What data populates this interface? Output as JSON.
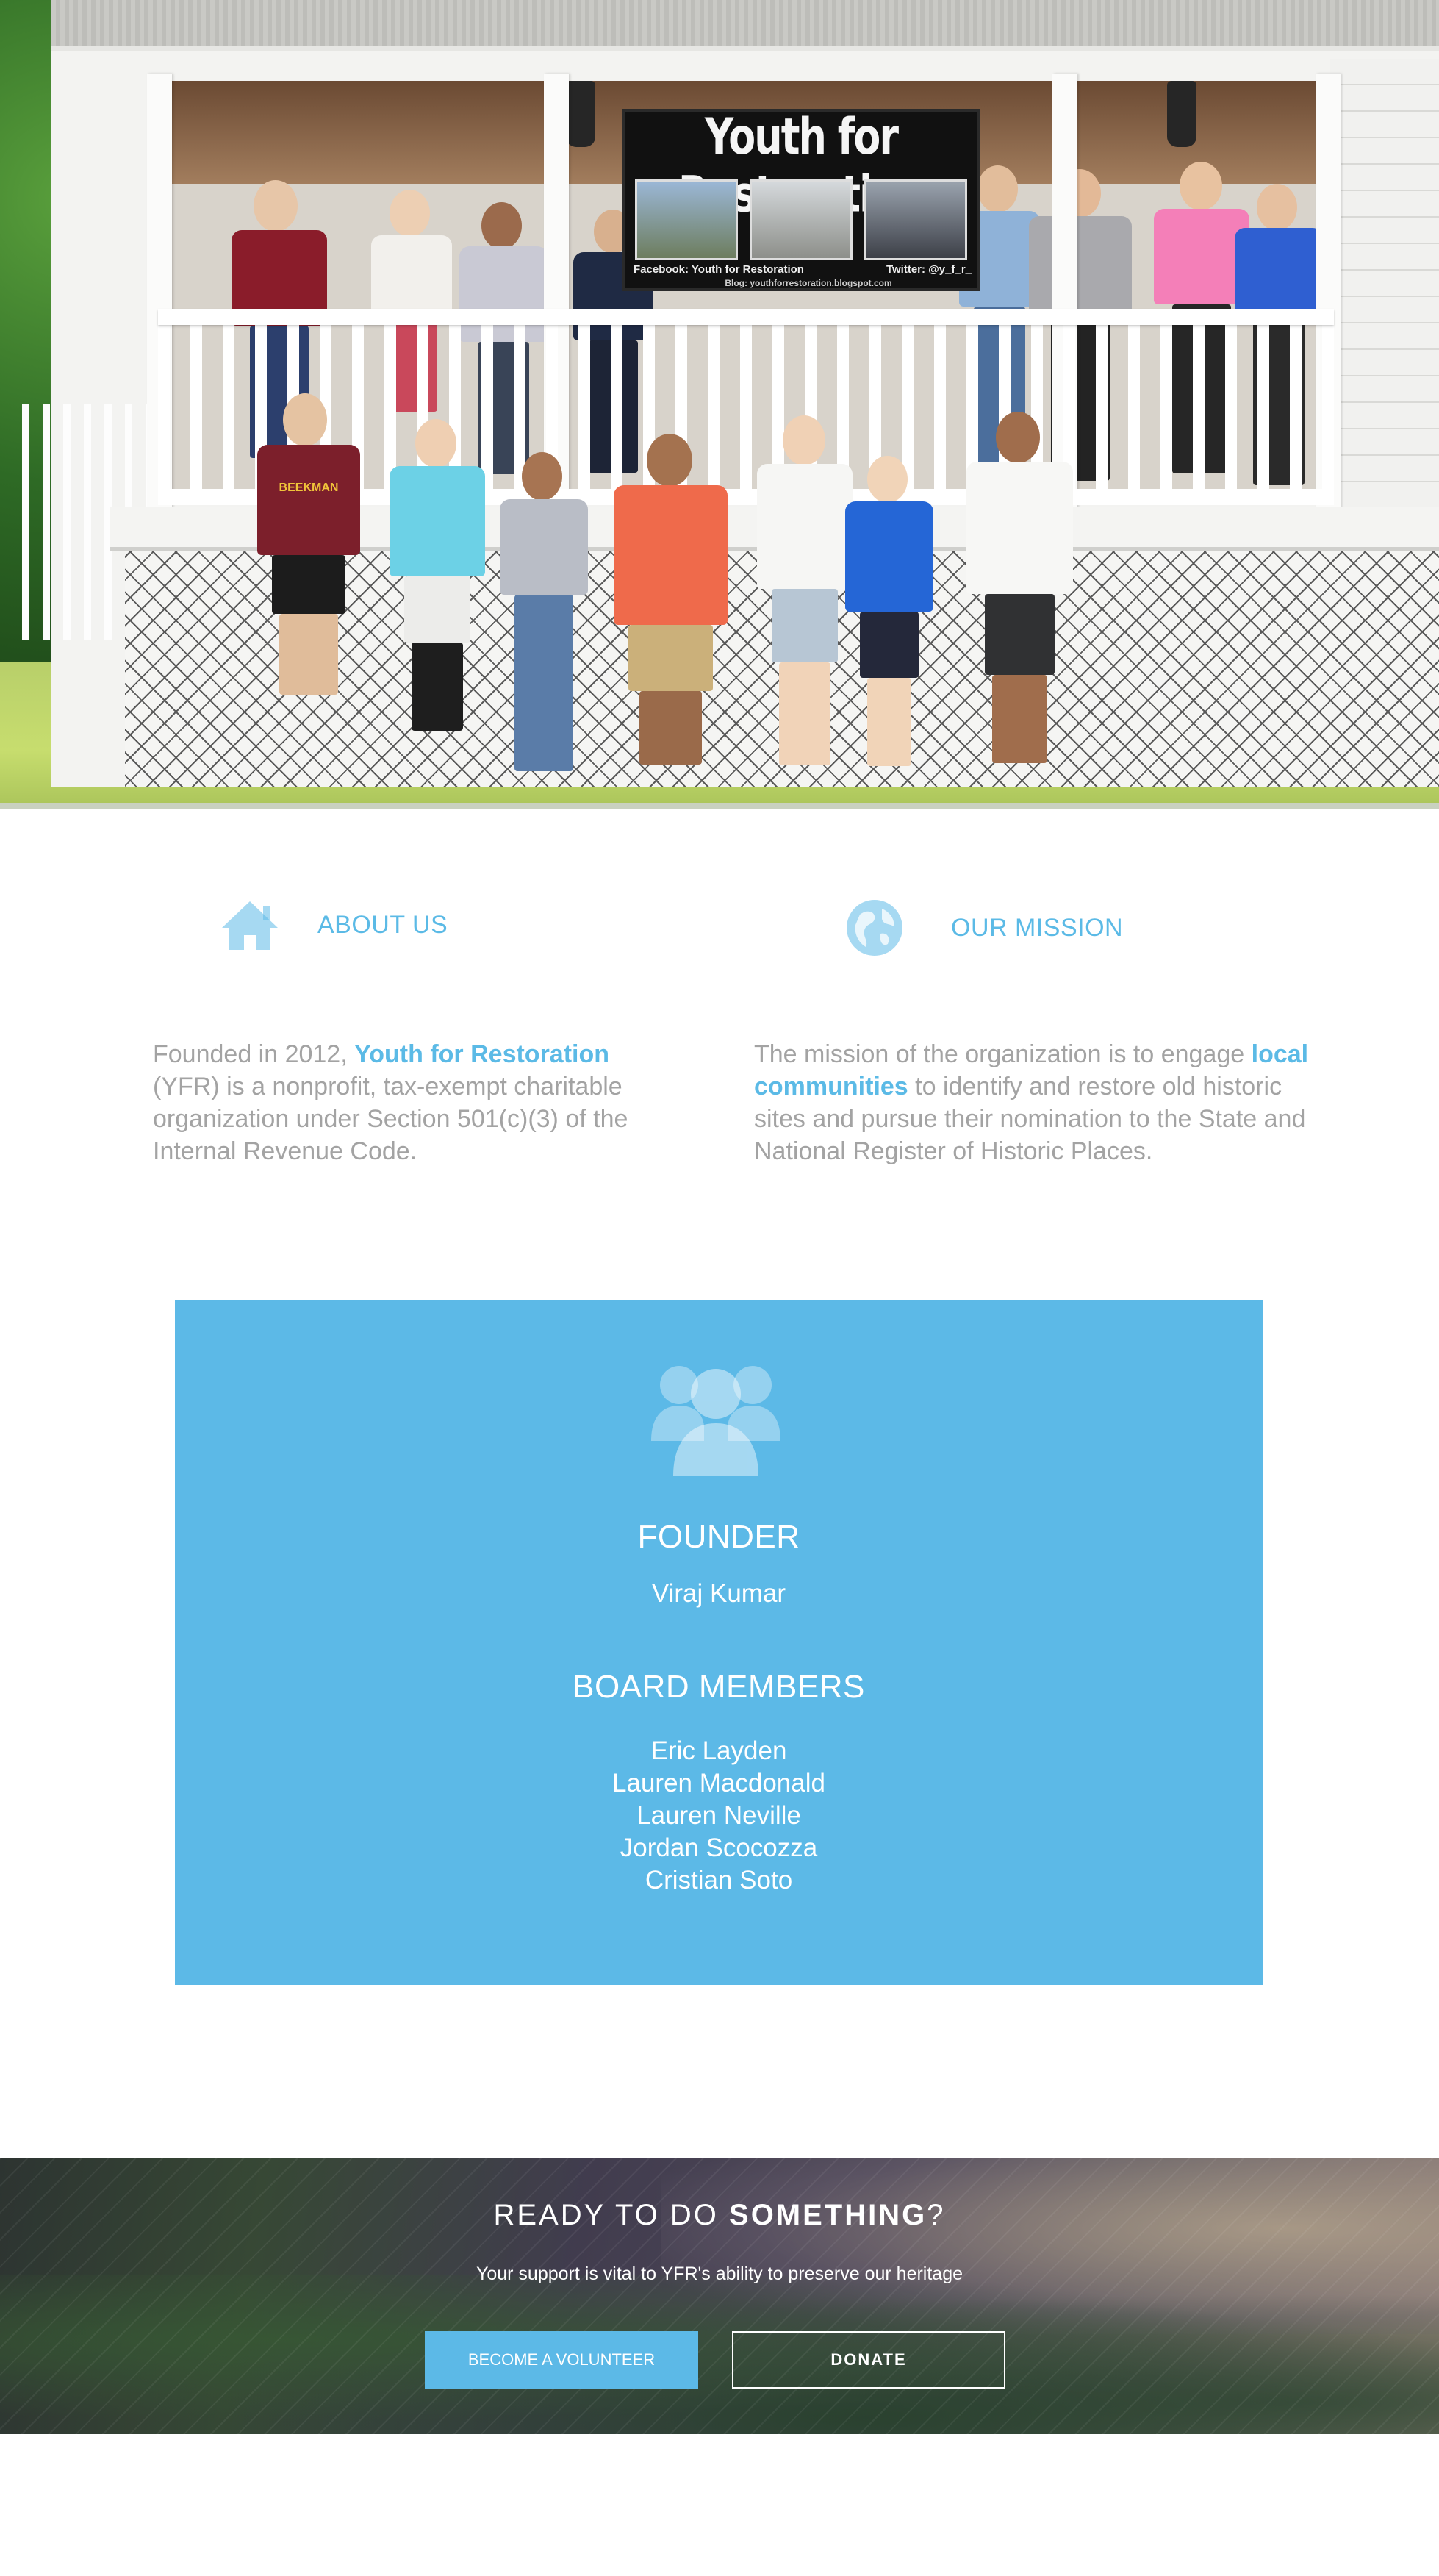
{
  "hero": {
    "banner_title": "Youth for Restoration",
    "banner_facebook": "Facebook: Youth for Restoration",
    "banner_twitter": "Twitter: @y_f_r_",
    "banner_url": "Blog: youthforrestoration.blogspot.com",
    "shirt_text": "BEEKMAN"
  },
  "about": {
    "icon": "home-icon",
    "heading": "ABOUT US",
    "text_before": "Founded in 2012, ",
    "highlight": "Youth for Restoration",
    "text_after": " (YFR) is a nonprofit, tax-exempt charitable organization under Section 501(c)(3) of the Internal Revenue Code."
  },
  "mission": {
    "icon": "globe-icon",
    "heading": "OUR MISSION",
    "text_before": "The mission of the organization is to engage ",
    "highlight": "local communities",
    "text_after": " to identify and restore old historic sites and pursue their nomination to the State and National Register of Historic Places."
  },
  "team": {
    "icon": "group-icon",
    "founder_heading": "FOUNDER",
    "founder_name": "Viraj Kumar",
    "board_heading": "BOARD MEMBERS",
    "members": [
      "Eric Layden",
      "Lauren Macdonald",
      "Lauren Neville",
      "Jordan Scocozza",
      "Cristian Soto"
    ]
  },
  "cta": {
    "title_plain": "READY TO DO ",
    "title_bold": "SOMETHING",
    "title_end": "?",
    "subtitle": "Your support is vital to YFR's ability to preserve our heritage",
    "volunteer_label": "BECOME A VOLUNTEER",
    "donate_label": "DONATE"
  },
  "colors": {
    "accent": "#5cb9e7",
    "body_text": "#a3a3a3",
    "background": "#ffffff"
  }
}
